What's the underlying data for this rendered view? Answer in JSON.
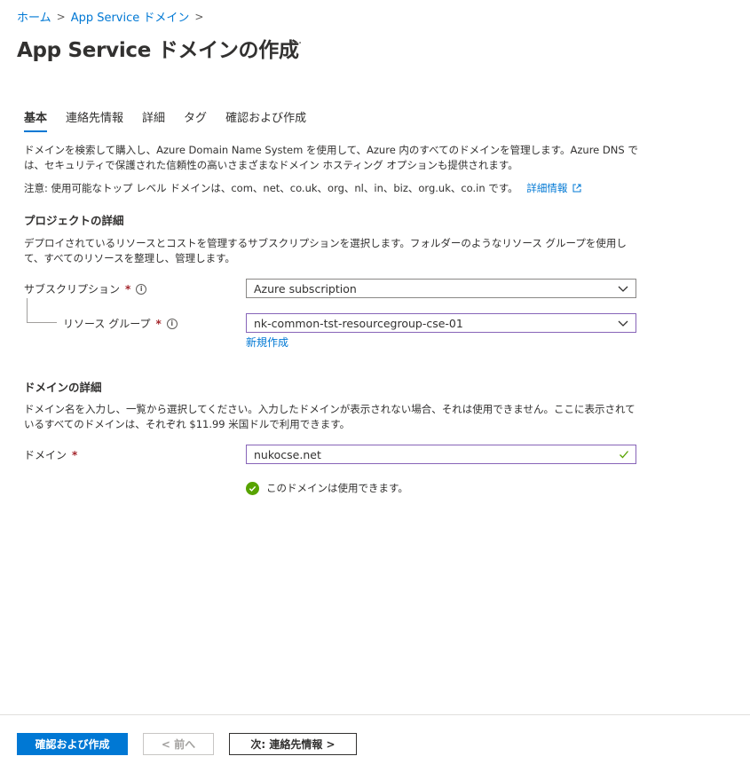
{
  "breadcrumb": {
    "items": [
      "ホーム",
      "App Service ドメイン"
    ]
  },
  "header": {
    "title": "App Service ドメインの作成",
    "more": "···"
  },
  "tabs": [
    {
      "label": "基本",
      "active": true
    },
    {
      "label": "連絡先情報"
    },
    {
      "label": "詳細"
    },
    {
      "label": "タグ"
    },
    {
      "label": "確認および作成"
    }
  ],
  "intro": {
    "description": "ドメインを検索して購入し、Azure Domain Name System を使用して、Azure 内のすべてのドメインを管理します。Azure DNS では、セキュリティで保護された信頼性の高いさまざまなドメイン ホスティング オプションも提供されます。",
    "note": "注意: 使用可能なトップ レベル ドメインは、com、net、co.uk、org、nl、in、biz、org.uk、co.in です。",
    "note_link": "詳細情報"
  },
  "project": {
    "title": "プロジェクトの詳細",
    "description": "デプロイされているリソースとコストを管理するサブスクリプションを選択します。フォルダーのようなリソース グループを使用して、すべてのリソースを整理し、管理します。",
    "subscription_label": "サブスクリプション",
    "subscription_value": "Azure subscription",
    "resource_group_label": "リソース グループ",
    "resource_group_value": "nk-common-tst-resourcegroup-cse-01",
    "new_link": "新規作成"
  },
  "domain": {
    "title": "ドメインの詳細",
    "description": "ドメイン名を入力し、一覧から選択してください。入力したドメインが表示されない場合、それは使用できません。ここに表示されているすべてのドメインは、それぞれ $11.99 米国ドルで利用できます。",
    "label": "ドメイン",
    "value": "nukocse.net",
    "status": "このドメインは使用できます。"
  },
  "footer": {
    "review_button": "確認および作成",
    "prev_button": "< 前へ",
    "next_button": "次: 連絡先情報 >"
  },
  "colors": {
    "accent": "#0078d4",
    "required": "#a4262c",
    "focus_border": "#8764b8",
    "success": "#57a300"
  }
}
